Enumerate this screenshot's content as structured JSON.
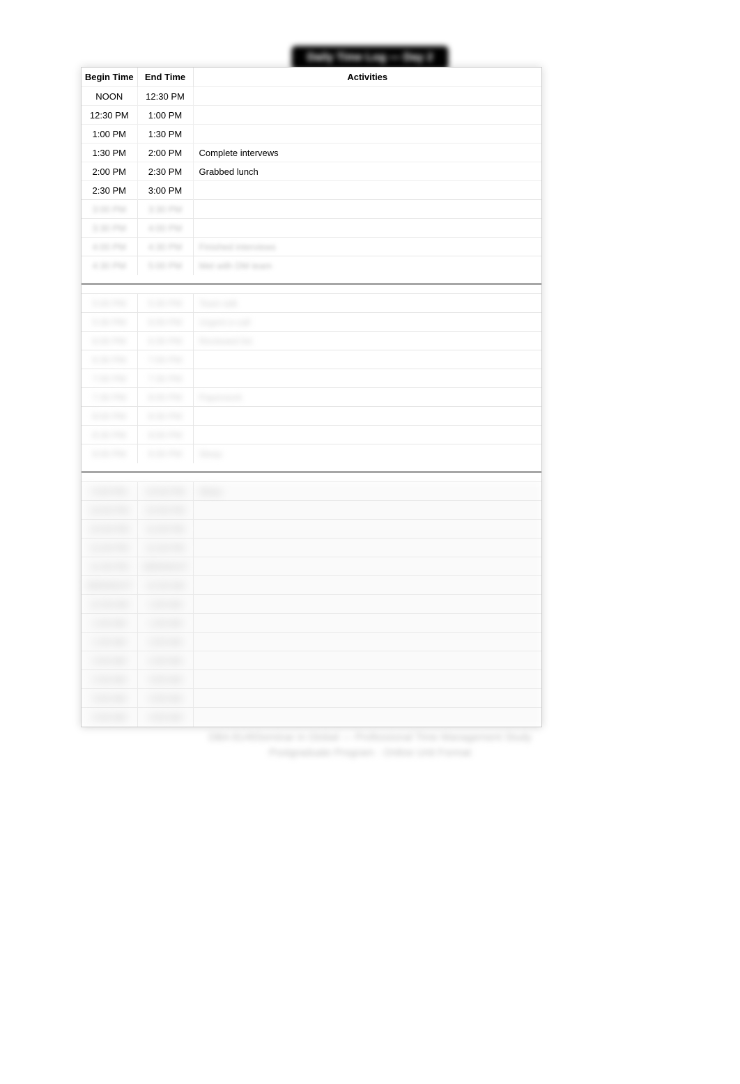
{
  "title_pill": "Daily Time Log — Day 2",
  "table": {
    "headers": {
      "begin": "Begin Time",
      "end": "End Time",
      "activities": "Activities"
    },
    "tier_clear": [
      {
        "begin": "NOON",
        "end": "12:30 PM",
        "activity": ""
      },
      {
        "begin": "12:30 PM",
        "end": "1:00 PM",
        "activity": ""
      },
      {
        "begin": "1:00 PM",
        "end": "1:30 PM",
        "activity": ""
      },
      {
        "begin": "1:30 PM",
        "end": "2:00 PM",
        "activity": "Complete intervews"
      },
      {
        "begin": "2:00 PM",
        "end": "2:30 PM",
        "activity": "Grabbed lunch"
      },
      {
        "begin": "2:30 PM",
        "end": "3:00 PM",
        "activity": ""
      }
    ],
    "tier_soft": [
      {
        "begin": "3:00 PM",
        "end": "3:30 PM",
        "activity": ""
      },
      {
        "begin": "3:30 PM",
        "end": "4:00 PM",
        "activity": ""
      },
      {
        "begin": "4:00 PM",
        "end": "4:30 PM",
        "activity": "Finished interviews"
      },
      {
        "begin": "4:30 PM",
        "end": "5:00 PM",
        "activity": "Met with DM team"
      }
    ],
    "tier_mid": [
      {
        "begin": "5:00 PM",
        "end": "5:30 PM",
        "activity": "Team talk"
      },
      {
        "begin": "5:30 PM",
        "end": "6:00 PM",
        "activity": "Urgent e-call"
      },
      {
        "begin": "6:00 PM",
        "end": "6:30 PM",
        "activity": "Reviewed list"
      },
      {
        "begin": "6:30 PM",
        "end": "7:00 PM",
        "activity": ""
      },
      {
        "begin": "7:00 PM",
        "end": "7:30 PM",
        "activity": ""
      },
      {
        "begin": "7:30 PM",
        "end": "8:00 PM",
        "activity": "Paperwork"
      },
      {
        "begin": "8:00 PM",
        "end": "8:30 PM",
        "activity": ""
      },
      {
        "begin": "8:30 PM",
        "end": "9:00 PM",
        "activity": ""
      },
      {
        "begin": "9:00 PM",
        "end": "9:30 PM",
        "activity": "Sleep"
      }
    ],
    "tier_heavy": [
      {
        "begin": "9:30 PM",
        "end": "10:00 PM",
        "activity": "Sleep"
      },
      {
        "begin": "10:00 PM",
        "end": "10:30 PM",
        "activity": ""
      },
      {
        "begin": "10:30 PM",
        "end": "11:00 PM",
        "activity": ""
      },
      {
        "begin": "11:00 PM",
        "end": "11:30 PM",
        "activity": ""
      },
      {
        "begin": "11:30 PM",
        "end": "MIDNIGHT",
        "activity": ""
      },
      {
        "begin": "MIDNIGHT",
        "end": "12:30 AM",
        "activity": ""
      },
      {
        "begin": "12:30 AM",
        "end": "1:00 AM",
        "activity": ""
      },
      {
        "begin": "1:00 AM",
        "end": "1:30 AM",
        "activity": ""
      },
      {
        "begin": "1:30 AM",
        "end": "2:00 AM",
        "activity": ""
      },
      {
        "begin": "2:00 AM",
        "end": "2:30 AM",
        "activity": ""
      },
      {
        "begin": "2:30 AM",
        "end": "3:00 AM",
        "activity": ""
      },
      {
        "begin": "3:00 AM",
        "end": "3:30 AM",
        "activity": ""
      },
      {
        "begin": "3:30 AM",
        "end": "4:00 AM",
        "activity": ""
      }
    ]
  },
  "footer": {
    "line1": "DBA 8149Seminar in Global — Professional Time Management Study",
    "line2": "Postgraduate Program · Online Unit Format"
  }
}
